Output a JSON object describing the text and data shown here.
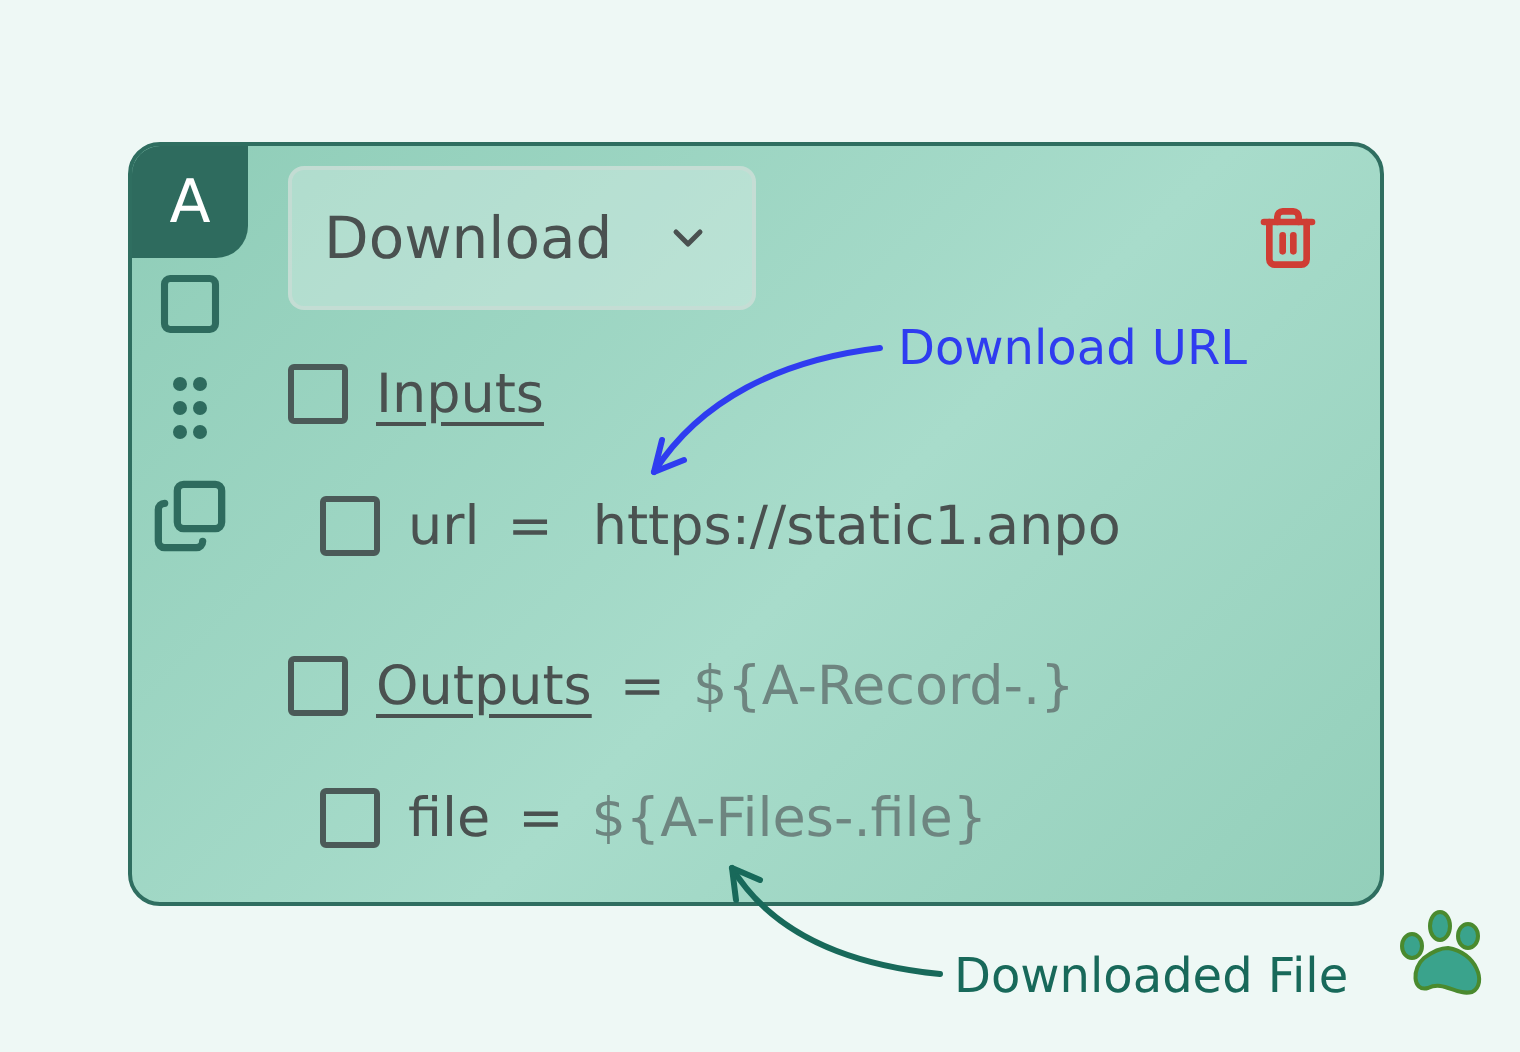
{
  "badge": "A",
  "action": {
    "label": "Download"
  },
  "sections": [
    {
      "label": "Inputs",
      "checked": false,
      "fields": [
        {
          "name": "url",
          "separator": "=",
          "value": "https://static1.anpo",
          "kind": "literal",
          "checked": false
        }
      ]
    },
    {
      "label": "Outputs",
      "checked": false,
      "separator": "=",
      "value": "${A-Record-.}",
      "fields": [
        {
          "name": "file",
          "separator": "=",
          "value": "${A-Files-.file}",
          "kind": "reference",
          "checked": false
        }
      ]
    }
  ],
  "annotations": [
    {
      "text": "Download URL",
      "color": "#2f3cf0"
    },
    {
      "text": "Downloaded File",
      "color": "#18695a"
    }
  ]
}
